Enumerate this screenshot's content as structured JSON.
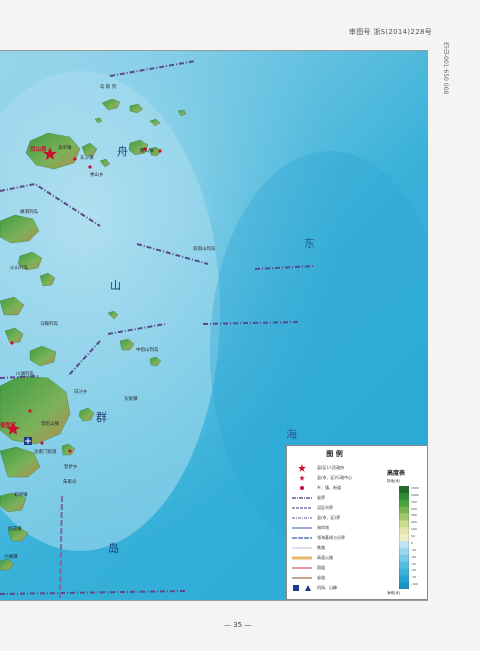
{
  "header": {
    "text": "审图号 浙S(2014)228号",
    "vertical_code": "岱山-001·650 008"
  },
  "map": {
    "labels": {
      "archipelago_1": "舟",
      "archipelago_2": "山",
      "archipelago_3": "群",
      "archipelago_4": "岛",
      "sea_far": "东",
      "sea_far2": "海",
      "island_north": "岛 斯 列",
      "county_seat": "岱山县",
      "town_1": "高亭镇",
      "town_2": "东沙镇",
      "town_3": "衢山镇",
      "town_4": "秀山乡",
      "district": "普陀区",
      "town_5": "沈家门街道",
      "town_6": "普陀山镇",
      "island_east": "浪岗山列岛",
      "island_mid": "中街山列岛",
      "island_a": "东极镇",
      "island_b": "虾峙镇",
      "island_c": "桃花镇",
      "island_d": "六横镇",
      "island_e": "白沙乡",
      "island_f": "登步乡",
      "island_g": "朱家尖",
      "island_h": "嵊泗列岛",
      "island_i": "火山列岛",
      "island_j": "马鞍列岛",
      "island_k": "川湖列岛"
    }
  },
  "legend": {
    "title": "图 例",
    "items": [
      {
        "label": "县(区)人民政府",
        "symbol": "star-large",
        "color": "#c8102e"
      },
      {
        "label": "县(市、区)行政中心",
        "symbol": "star-small",
        "color": "#c8102e"
      },
      {
        "label": "乡、镇、街道",
        "symbol": "dot",
        "color": "#c8102e"
      },
      {
        "label": "省界",
        "symbol": "dash-dot",
        "color": "#3a3a8a"
      },
      {
        "label": "设区市界",
        "symbol": "dash",
        "color": "#5a5a9a"
      },
      {
        "label": "县(市、区)界",
        "symbol": "dash-dot-thin",
        "color": "#7a7ab0"
      },
      {
        "label": "海岸线",
        "symbol": "line",
        "color": "#5b7ec2"
      },
      {
        "label": "领海基线与分界",
        "symbol": "dash-long",
        "color": "#3a5b9a"
      },
      {
        "label": "铁路",
        "symbol": "line-thin",
        "color": "#6b8cc6"
      },
      {
        "label": "高速公路",
        "symbol": "band",
        "color": "#e8b96a"
      },
      {
        "label": "国道",
        "symbol": "band-thin",
        "color": "#e79a9a"
      },
      {
        "label": "省道",
        "symbol": "band-thin2",
        "color": "#c8a58a"
      },
      {
        "label": "机场、山峰",
        "symbol": "airport-peak",
        "color": "#1a3a8a"
      }
    ],
    "elevation": {
      "title": "高度表",
      "unit_top": "陆地(米)",
      "unit_bottom": "海域(米)",
      "ticks": [
        "1500",
        "1000",
        "700",
        "500",
        "300",
        "200",
        "100",
        "50",
        "0",
        "-10",
        "-20",
        "-30",
        "-50",
        "-70",
        "-100"
      ]
    }
  },
  "footer": {
    "page_number": "— 35 —"
  },
  "colors": {
    "shallow_sea": "#9fd6ec",
    "mid_sea": "#38b1d9",
    "deep_sea": "#2aa9d6",
    "land_green": "#4fa14a",
    "land_brown": "#a47a45",
    "border_line": "#5a4a8a",
    "red_symbol": "#c8102e"
  }
}
